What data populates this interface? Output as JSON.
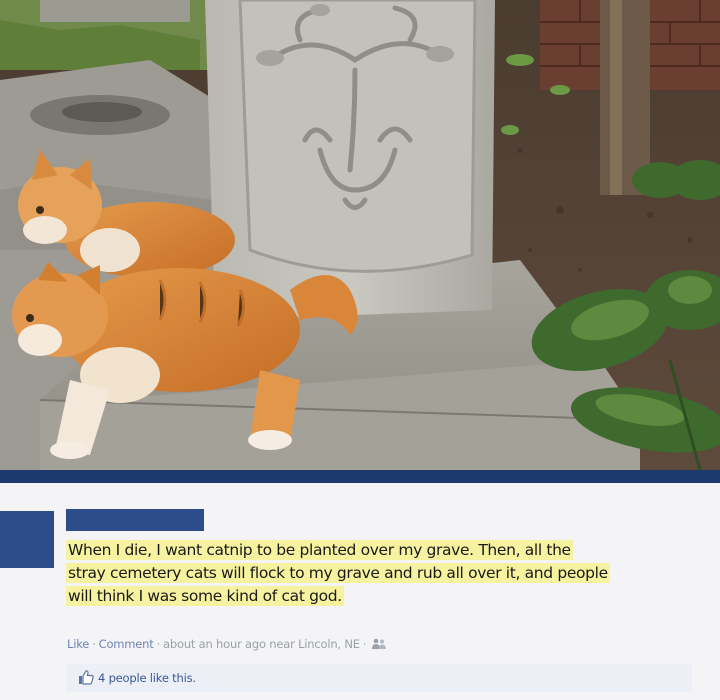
{
  "post": {
    "author_name": "",
    "status_lines": [
      "When I die, I want catnip to be planted over my grave. Then, all the",
      "stray cemetery cats will flock to my grave and rub all over it, and people",
      "will think I was some kind of cat god."
    ],
    "actions": {
      "like_label": "Like",
      "comment_label": "Comment",
      "timestamp": "about an hour ago near Lincoln, NE"
    },
    "likes_text": "4 people like this.",
    "icons": {
      "audience": "people-icon",
      "like": "thumbs-up-icon"
    }
  },
  "colors": {
    "facebook_blue": "#2c4c8a",
    "divider": "#1d3a6e",
    "highlight": "#f6f2a0",
    "link": "#6d84b4"
  }
}
